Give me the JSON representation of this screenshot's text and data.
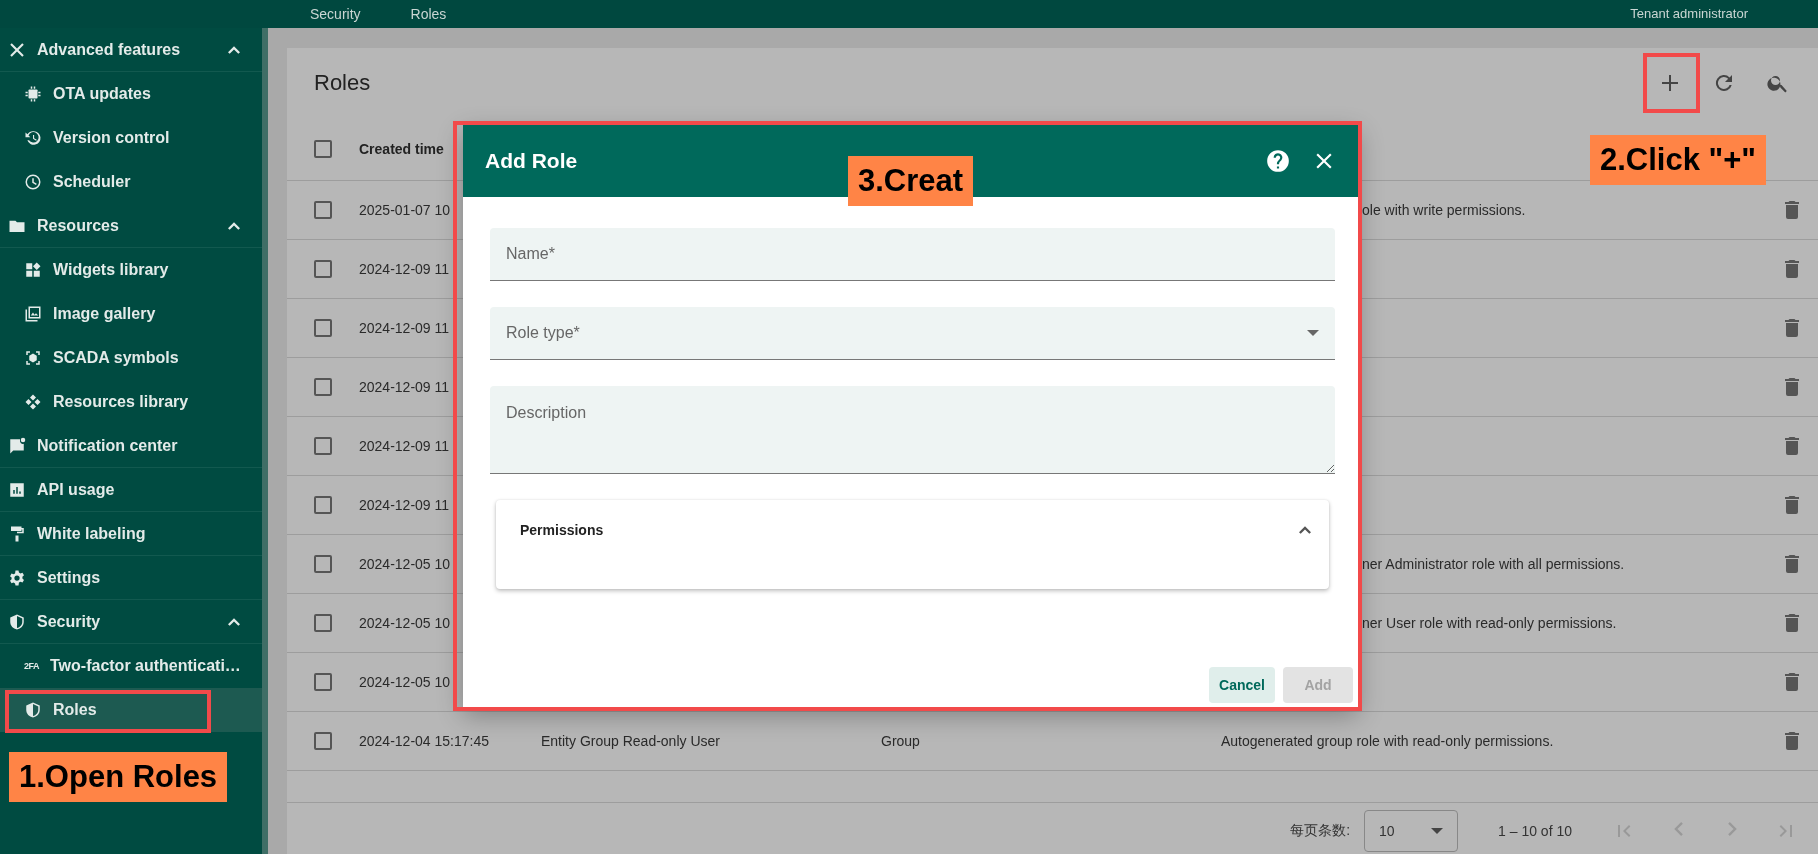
{
  "top_bar": {
    "breadcrumbs": [
      {
        "label": "Security"
      },
      {
        "label": "Roles"
      }
    ],
    "user_role": "Tenant administrator"
  },
  "sidebar": {
    "items": [
      {
        "label": "Advanced features",
        "expanded": true,
        "selected": false,
        "children": [
          {
            "label": "OTA updates",
            "selected": false
          },
          {
            "label": "Version control",
            "selected": false
          },
          {
            "label": "Scheduler",
            "selected": false
          }
        ]
      },
      {
        "label": "Resources",
        "expanded": true,
        "selected": false,
        "children": [
          {
            "label": "Widgets library",
            "selected": false
          },
          {
            "label": "Image gallery",
            "selected": false
          },
          {
            "label": "SCADA symbols",
            "selected": false
          },
          {
            "label": "Resources library",
            "selected": false
          }
        ]
      },
      {
        "label": "Notification center",
        "selected": false
      },
      {
        "label": "API usage",
        "selected": false
      },
      {
        "label": "White labeling",
        "selected": false
      },
      {
        "label": "Settings",
        "selected": false
      },
      {
        "label": "Security",
        "expanded": true,
        "selected": false,
        "children": [
          {
            "label": "Two-factor authenticati…",
            "badge": "2FA",
            "selected": false
          },
          {
            "label": "Roles",
            "selected": true
          }
        ]
      }
    ]
  },
  "page": {
    "title": "Roles",
    "table": {
      "columns": [
        "Created time"
      ],
      "all_checked": false,
      "rows": [
        {
          "checked": false,
          "created_time": "2025-01-07 10",
          "description": "ole with write permissions.",
          "description_cut": true
        },
        {
          "checked": false,
          "created_time": "2024-12-09 11"
        },
        {
          "checked": false,
          "created_time": "2024-12-09 11"
        },
        {
          "checked": false,
          "created_time": "2024-12-09 11"
        },
        {
          "checked": false,
          "created_time": "2024-12-09 11"
        },
        {
          "checked": false,
          "created_time": "2024-12-09 11"
        },
        {
          "checked": false,
          "created_time": "2024-12-05 10",
          "description": "ner Administrator role with all permissions.",
          "description_cut": true
        },
        {
          "checked": false,
          "created_time": "2024-12-05 10",
          "description": "ner User role with read-only permissions.",
          "description_cut": true
        },
        {
          "checked": false,
          "created_time": "2024-12-05 10"
        },
        {
          "checked": false,
          "created_time": "2024-12-04 15:17:45",
          "name": "Entity Group Read-only User",
          "type": "Group",
          "description": "Autogenerated group role with read-only permissions.",
          "description_cut": false
        }
      ]
    },
    "paginator": {
      "page_size_label": "每页条数:",
      "page_size": "10",
      "range": "1 – 10 of 10"
    }
  },
  "dialog": {
    "title": "Add Role",
    "fields": [
      {
        "kind": "input",
        "placeholder": "Name*"
      },
      {
        "kind": "select",
        "placeholder": "Role type*"
      },
      {
        "kind": "textarea",
        "placeholder": "Description"
      }
    ],
    "panel": {
      "title": "Permissions",
      "expanded": true
    },
    "buttons": [
      {
        "label": "Cancel",
        "disabled": false
      },
      {
        "label": "Add",
        "disabled": true
      }
    ]
  },
  "annotations": [
    {
      "kind": "label",
      "text": "1.Open Roles"
    },
    {
      "kind": "label",
      "text": "2.Click \"+\""
    },
    {
      "kind": "label",
      "text": "3.Creat"
    }
  ]
}
